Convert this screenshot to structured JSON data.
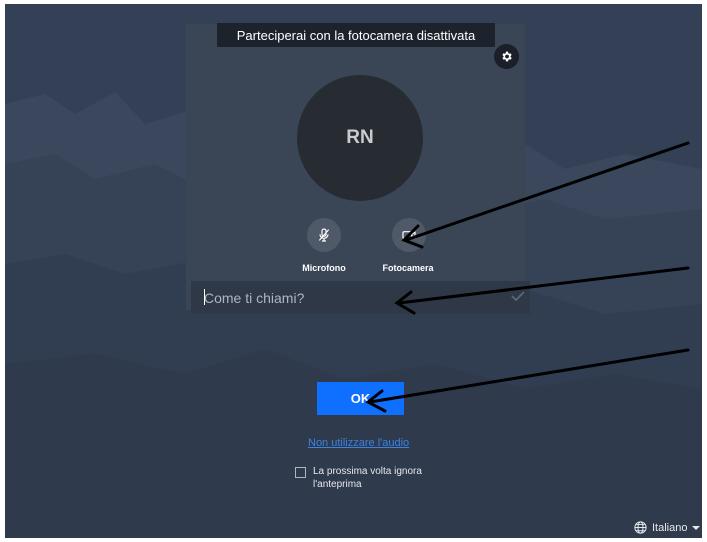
{
  "prejoin": {
    "banner_text": "Parteciperai con la fotocamera disattivata",
    "settings_icon": "gear-icon",
    "avatar_initials": "RN",
    "microphone": {
      "label": "Microfono",
      "icon": "microphone-muted-icon",
      "state": "muted"
    },
    "camera": {
      "label": "Fotocamera",
      "icon": "camera-off-icon",
      "state": "off"
    },
    "name_input": {
      "placeholder": "Come ti chiami?",
      "value": "",
      "confirm_icon": "check-icon"
    },
    "ok_label": "OK",
    "no_audio_link": "Non utilizzare l'audio",
    "skip_preview_label": "La prossima volta ignora l'anteprima",
    "skip_preview_checked": false
  },
  "footer": {
    "language_icon": "globe-icon",
    "language": "Italiano"
  },
  "annotations": {
    "arrow_icon": "arrow-annotation-icon",
    "count": 3
  },
  "colors": {
    "background": "#334055",
    "accent": "#0f6fff",
    "link": "#3a82e3"
  }
}
